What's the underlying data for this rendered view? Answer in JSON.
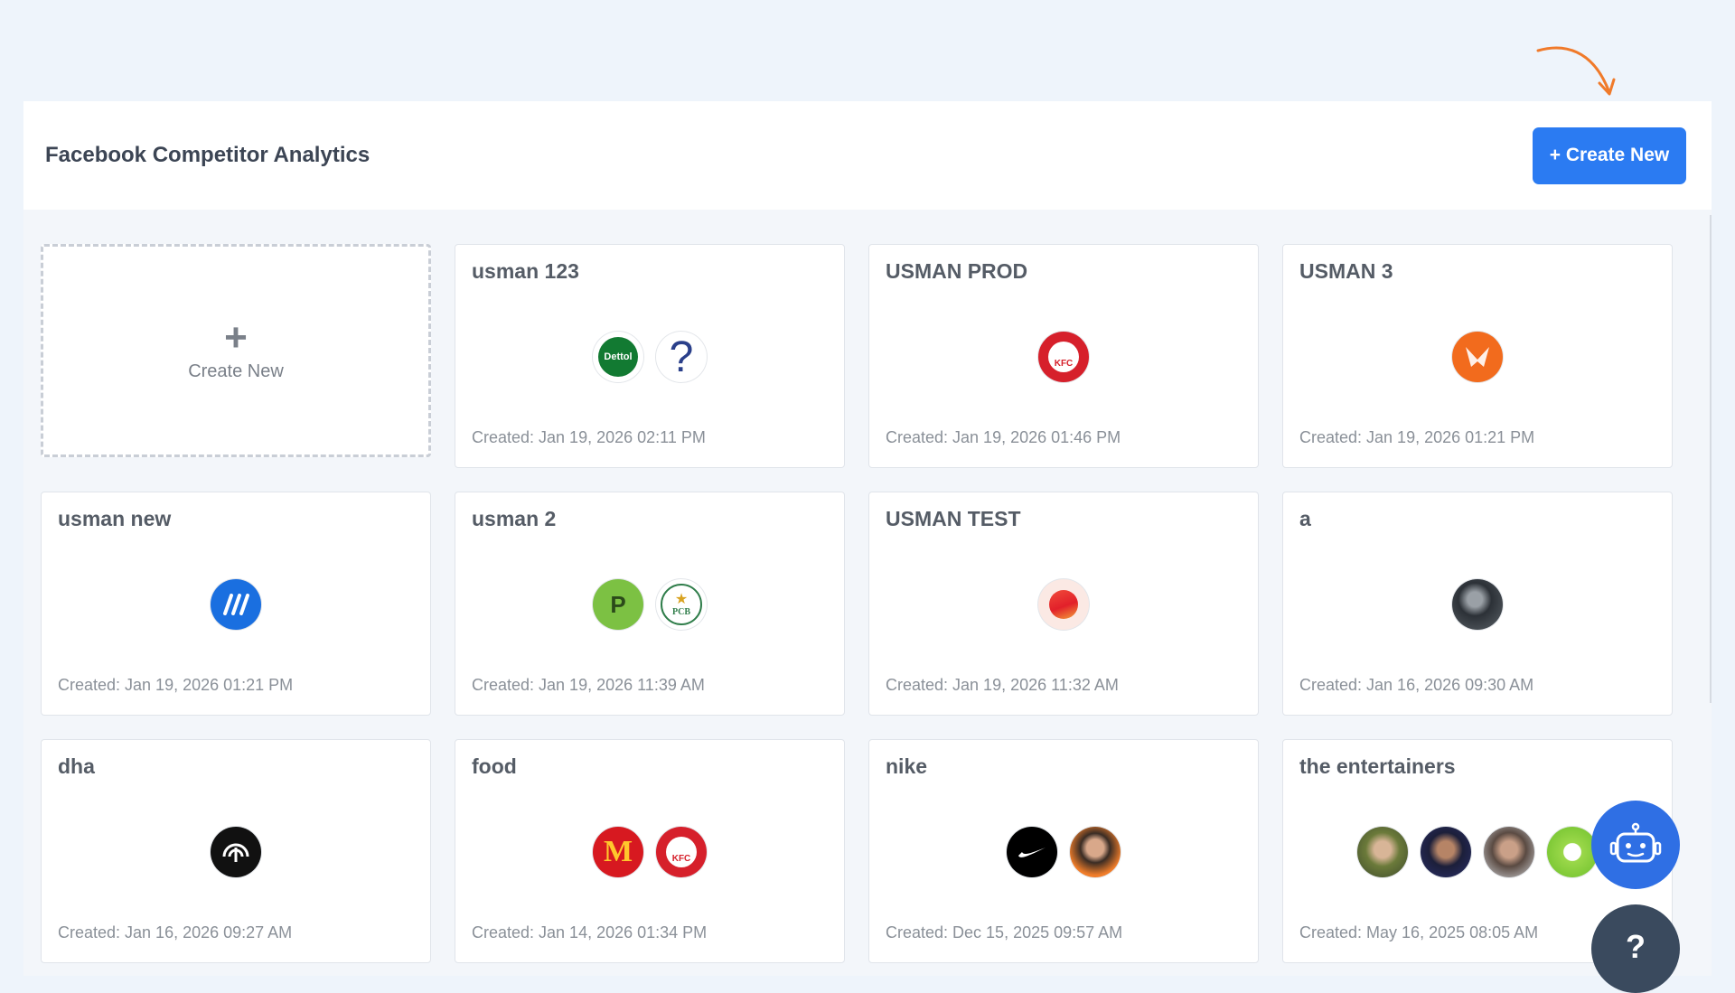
{
  "header": {
    "title": "Facebook Competitor Analytics",
    "create_button": "+ Create New"
  },
  "create_card": {
    "plus": "+",
    "label": "Create New"
  },
  "cards": [
    {
      "title": "usman 123",
      "date": "Created: Jan 19, 2026 02:11 PM"
    },
    {
      "title": "USMAN PROD",
      "date": "Created: Jan 19, 2026 01:46 PM"
    },
    {
      "title": "USMAN 3",
      "date": "Created: Jan 19, 2026 01:21 PM"
    },
    {
      "title": "usman new",
      "date": "Created: Jan 19, 2026 01:21 PM"
    },
    {
      "title": "usman 2",
      "date": "Created: Jan 19, 2026 11:39 AM"
    },
    {
      "title": "USMAN TEST",
      "date": "Created: Jan 19, 2026 11:32 AM"
    },
    {
      "title": "a",
      "date": "Created: Jan 16, 2026 09:30 AM"
    },
    {
      "title": "dha",
      "date": "Created: Jan 16, 2026 09:27 AM"
    },
    {
      "title": "food",
      "date": "Created: Jan 14, 2026 01:34 PM"
    },
    {
      "title": "nike",
      "date": "Created: Dec 15, 2025 09:57 AM"
    },
    {
      "title": "the entertainers",
      "date": "Created: May 16, 2025 08:05 AM"
    }
  ],
  "logo_text": {
    "dettol": "Dettol",
    "unknown": "?",
    "kfc": "KFC",
    "p": "P",
    "pcb": "PCB",
    "mcd": "M"
  },
  "help_button": "?",
  "colors": {
    "accent": "#2b7bf2",
    "arrow": "#f07a2a",
    "bot": "#2f6fe4",
    "help": "#3a4a5e"
  },
  "icons": [
    "curved-arrow-icon",
    "plus-icon",
    "robot-icon",
    "help-icon"
  ]
}
